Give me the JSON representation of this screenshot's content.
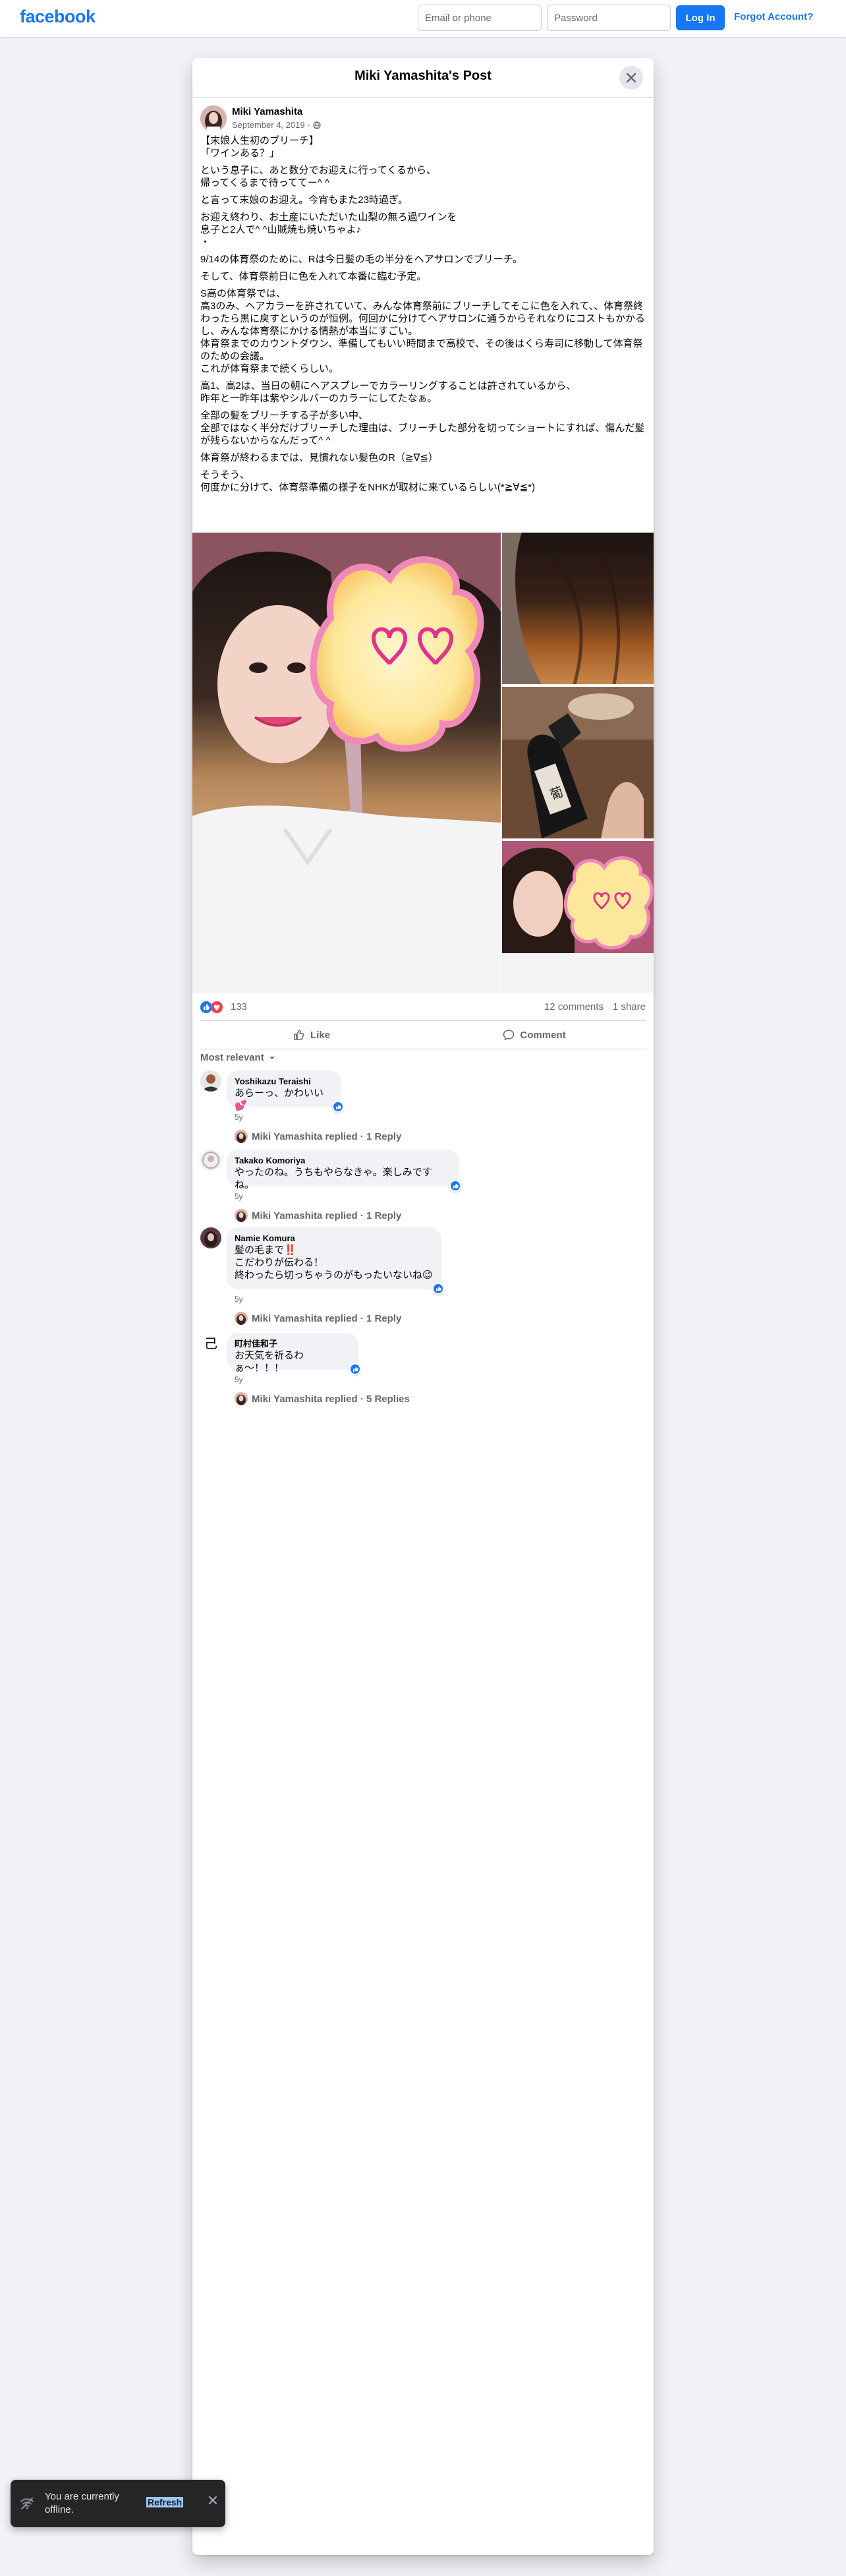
{
  "topbar": {
    "logo": "facebook",
    "email_placeholder": "Email or phone",
    "password_placeholder": "Password",
    "login_label": "Log In",
    "forgot_label": "Forgot Account?"
  },
  "dialog": {
    "title": "Miki Yamashita's Post"
  },
  "post": {
    "author": "Miki Yamashita",
    "date": "September 4, 2019 ·",
    "paragraphs": [
      "【末娘人生初のブリーチ】\n「ワインある？」",
      "という息子に、あと数分でお迎えに行ってくるから、\n帰ってくるまで待っててー^ ^",
      "と言って末娘のお迎え。今宵もまた23時過ぎ。",
      "お迎え終わり、お土産にいただいた山梨の無ろ過ワインを\n息子と2人で^ ^山賊焼も焼いちゃよ♪\n・",
      "9/14の体育祭のために、Rは今日髪の毛の半分をヘアサロンでブリーチ。",
      "そして、体育祭前日に色を入れて本番に臨む予定。",
      "S高の体育祭では、\n高3のみ、ヘアカラーを許されていて、みんな体育祭前にブリーチしてそこに色を入れて、、体育祭終わったら黒に戻すというのが恒例。何回かに分けてヘアサロンに通うからそれなりにコストもかかるし、みんな体育祭にかける情熱が本当にすごい。\n体育祭までのカウントダウン、準備してもいい時間まで高校で、その後はくら寿司に移動して体育祭のための会議。\nこれが体育祭まで続くらしい。",
      "高1、高2は、当日の朝にヘアスプレーでカラーリングすることは許されているから、\n昨年と一昨年は紫やシルバーのカラーにしてたなぁ。",
      "全部の髪をブリーチする子が多い中、\n全部ではなく半分だけブリーチした理由は、ブリーチした部分を切ってショートにすれば、傷んだ髪が残らないからなんだって^ ^",
      "体育祭が終わるまでは、見慣れない髪色のR（≧∇≦）",
      "そうそう、\n何度かに分けて、体育祭準備の様子をNHKが取材に来ているらしい(*≧∀≦*)"
    ],
    "reaction_count": "133",
    "comments_count": "12 comments",
    "shares_count": "1 share",
    "like_label": "Like",
    "comment_label": "Comment",
    "sort_label": "Most relevant"
  },
  "comments": [
    {
      "name": "Yoshikazu Teraishi",
      "text": "あらーっ、かわいい💕",
      "time": "5y",
      "reply": "Miki Yamashita replied · 1 Reply"
    },
    {
      "name": "Takako Komoriya",
      "text": "やったのね。うちもやらなきゃ。楽しみですね。",
      "time": "5y",
      "reply": "Miki Yamashita replied · 1 Reply"
    },
    {
      "name": "Namie Komura",
      "text": "髪の毛まで‼️\nこだわりが伝わる！\n終わったら切っちゃうのがもったいないね😉",
      "time": "5y",
      "reply": "Miki Yamashita replied · 1 Reply"
    },
    {
      "name": "町村佳和子",
      "text": "お天気を祈るわぁ〜！！！",
      "time": "5y",
      "reply": "Miki Yamashita replied · 5 Replies"
    }
  ],
  "toast": {
    "text": "You are currently offline.",
    "refresh": "Refresh"
  }
}
